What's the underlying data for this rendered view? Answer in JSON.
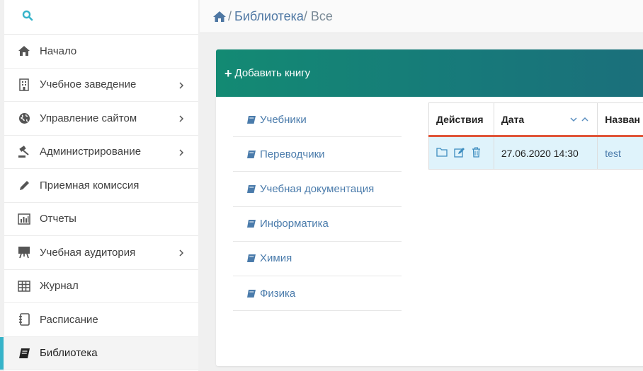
{
  "breadcrumb": {
    "section": "Библиотека",
    "separator": "/",
    "current": "Все"
  },
  "sidebar": {
    "items": [
      {
        "label": "Начало",
        "icon": "home-icon",
        "has_submenu": false
      },
      {
        "label": "Учебное заведение",
        "icon": "building-icon",
        "has_submenu": true
      },
      {
        "label": "Управление сайтом",
        "icon": "globe-icon",
        "has_submenu": true
      },
      {
        "label": "Администрирование",
        "icon": "gavel-icon",
        "has_submenu": true
      },
      {
        "label": "Приемная комиссия",
        "icon": "pencil-icon",
        "has_submenu": false
      },
      {
        "label": "Отчеты",
        "icon": "chart-icon",
        "has_submenu": false
      },
      {
        "label": "Учебная аудитория",
        "icon": "presentation-icon",
        "has_submenu": true
      },
      {
        "label": "Журнал",
        "icon": "table-icon",
        "has_submenu": false
      },
      {
        "label": "Расписание",
        "icon": "notebook-icon",
        "has_submenu": false
      },
      {
        "label": "Библиотека",
        "icon": "book-icon",
        "has_submenu": false,
        "active": true
      }
    ]
  },
  "card": {
    "add_button": "Добавить книгу"
  },
  "categories": [
    {
      "label": "Учебники"
    },
    {
      "label": "Переводчики"
    },
    {
      "label": "Учебная документация"
    },
    {
      "label": "Информатика"
    },
    {
      "label": "Химия"
    },
    {
      "label": "Физика"
    }
  ],
  "table": {
    "headers": {
      "actions": "Действия",
      "date": "Дата",
      "name": "Назван"
    },
    "rows": [
      {
        "date": "27.06.2020 14:30",
        "name": "test"
      }
    ]
  },
  "colors": {
    "accent": "#36b3c9",
    "header_green": "#138a73",
    "link": "#4a7bab",
    "table_row": "#dff3fb",
    "header_underline": "#e0563a"
  }
}
